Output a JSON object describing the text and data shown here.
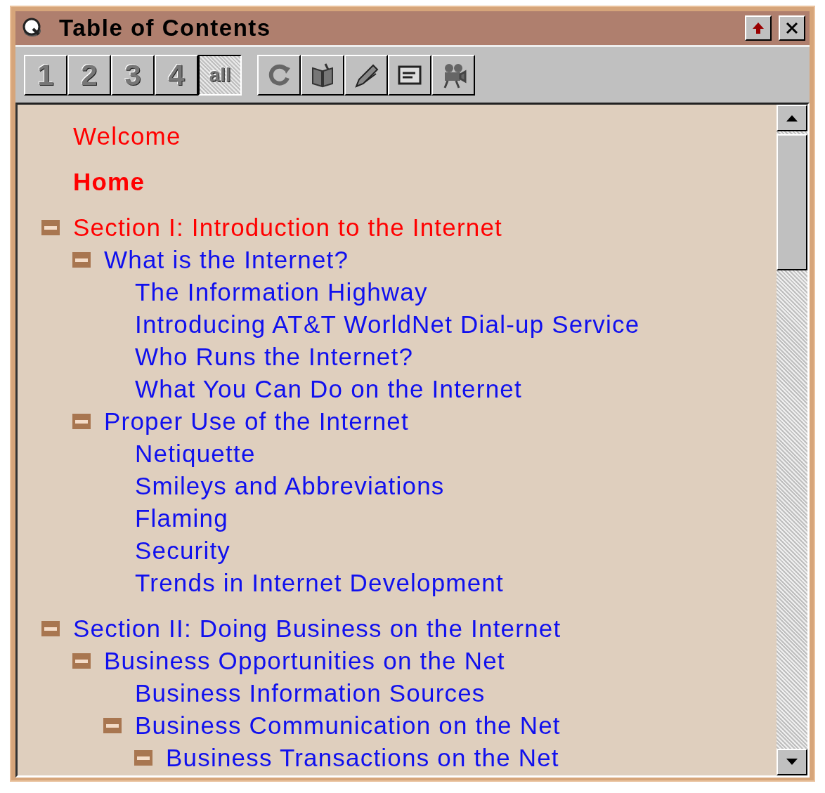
{
  "window": {
    "title": "Table of Contents"
  },
  "toolbar": {
    "levels": [
      {
        "label": "1",
        "selected": false
      },
      {
        "label": "2",
        "selected": false
      },
      {
        "label": "3",
        "selected": false
      },
      {
        "label": "4",
        "selected": false
      },
      {
        "label": "all",
        "selected": true
      }
    ]
  },
  "contents": [
    {
      "kind": "page",
      "label": "Welcome",
      "visited": true,
      "bold": false
    },
    {
      "kind": "page",
      "label": "Home",
      "visited": true,
      "bold": true
    },
    {
      "kind": "folder",
      "label": "Section I: Introduction to the Internet",
      "visited": true,
      "expanded": true,
      "children": [
        {
          "kind": "folder",
          "label": "What is the Internet?",
          "visited": false,
          "expanded": true,
          "children": [
            {
              "kind": "page",
              "label": "The Information Highway",
              "visited": false
            },
            {
              "kind": "page",
              "label": "Introducing AT&T WorldNet Dial-up Service",
              "visited": false
            },
            {
              "kind": "page",
              "label": "Who Runs the Internet?",
              "visited": false
            },
            {
              "kind": "page",
              "label": "What You Can Do on the Internet",
              "visited": false
            }
          ]
        },
        {
          "kind": "folder",
          "label": "Proper Use of the Internet",
          "visited": false,
          "expanded": true,
          "children": [
            {
              "kind": "page",
              "label": "Netiquette",
              "visited": false
            },
            {
              "kind": "page",
              "label": "Smileys and Abbreviations",
              "visited": false
            },
            {
              "kind": "page",
              "label": "Flaming",
              "visited": false
            },
            {
              "kind": "page",
              "label": "Security",
              "visited": false
            },
            {
              "kind": "page",
              "label": "Trends in Internet Development",
              "visited": false
            }
          ]
        }
      ]
    },
    {
      "kind": "folder",
      "label": "Section II: Doing Business on the Internet",
      "visited": false,
      "expanded": true,
      "children": [
        {
          "kind": "folder",
          "label": "Business Opportunities on the Net",
          "visited": false,
          "expanded": true,
          "children": [
            {
              "kind": "page",
              "label": "Business Information Sources",
              "visited": false
            },
            {
              "kind": "folder",
              "label": "Business Communication on the Net",
              "visited": false,
              "expanded": true,
              "children": [
                {
                  "kind": "folder",
                  "label": "Business Transactions on the Net",
                  "visited": false,
                  "expanded": true
                }
              ]
            }
          ]
        }
      ]
    }
  ]
}
